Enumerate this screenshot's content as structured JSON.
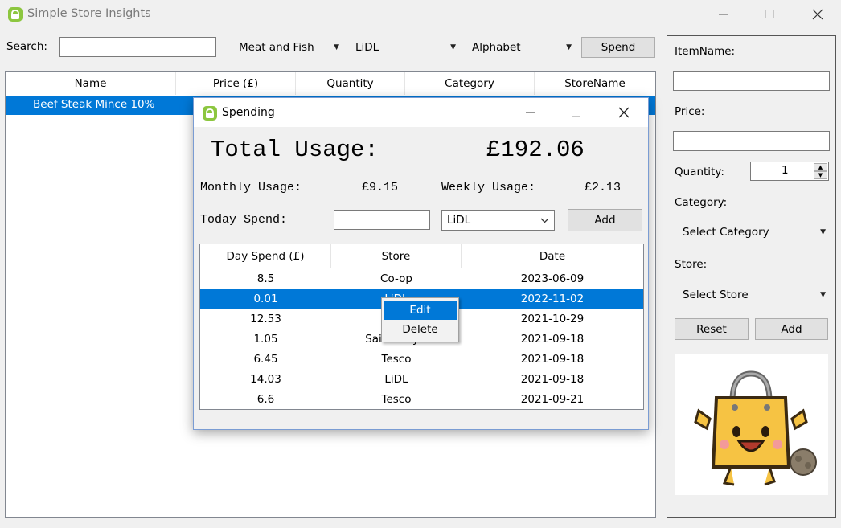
{
  "window": {
    "title": "Simple Store Insights"
  },
  "toolbar": {
    "search_label": "Search:",
    "search_value": "",
    "category_filter": "Meat and Fish",
    "store_filter": "LiDL",
    "sort_filter": "Alphabet",
    "spend_button": "Spend"
  },
  "main_table": {
    "columns": [
      "Name",
      "Price (£)",
      "Quantity",
      "Category",
      "StoreName"
    ],
    "rows": [
      {
        "name": "Beef Steak Mince 10%"
      }
    ]
  },
  "right_panel": {
    "item_name_label": "ItemName:",
    "item_name_value": "",
    "price_label": "Price:",
    "price_value": "",
    "quantity_label": "Quantity:",
    "quantity_value": "1",
    "category_label": "Category:",
    "category_select": "Select Category",
    "store_label": "Store:",
    "store_select": "Select Store",
    "reset_button": "Reset",
    "add_button": "Add"
  },
  "spending_dialog": {
    "title": "Spending",
    "total_label": "Total Usage:",
    "total_value": "£192.06",
    "monthly_label": "Monthly Usage:",
    "monthly_value": "£9.15",
    "weekly_label": "Weekly Usage:",
    "weekly_value": "£2.13",
    "today_label": "Today Spend:",
    "today_value": "",
    "store_select": "LiDL",
    "add_button": "Add",
    "table": {
      "columns": [
        "Day Spend (£)",
        "Store",
        "Date"
      ],
      "rows": [
        {
          "amount": "8.5",
          "store": "Co-op",
          "date": "2023-06-09"
        },
        {
          "amount": "0.01",
          "store": "LiDL",
          "date": "2022-11-02"
        },
        {
          "amount": "12.53",
          "store": "",
          "date": "2021-10-29"
        },
        {
          "amount": "1.05",
          "store": "Sainsbury's",
          "date": "2021-09-18"
        },
        {
          "amount": "6.45",
          "store": "Tesco",
          "date": "2021-09-18"
        },
        {
          "amount": "14.03",
          "store": "LiDL",
          "date": "2021-09-18"
        },
        {
          "amount": "6.6",
          "store": "Tesco",
          "date": "2021-09-21"
        }
      ],
      "selected_row": 1
    }
  },
  "context_menu": {
    "items": [
      "Edit",
      "Delete"
    ]
  },
  "colors": {
    "selection": "#0078d7",
    "mascot_bag": "#f6c343"
  }
}
